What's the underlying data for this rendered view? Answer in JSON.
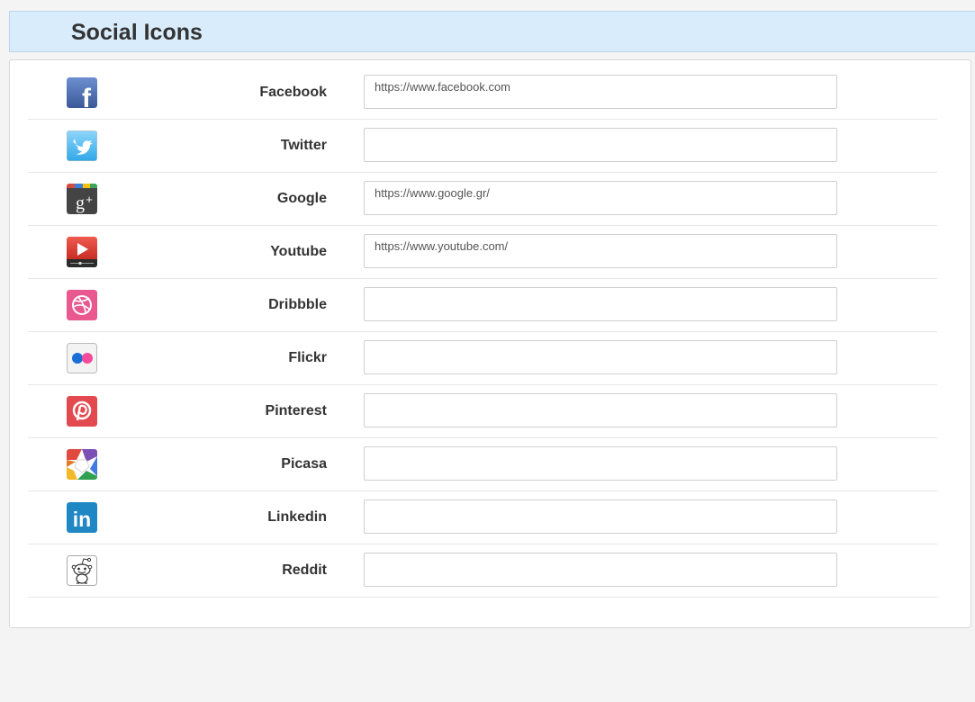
{
  "header": {
    "title": "Social Icons"
  },
  "rows": [
    {
      "icon": "facebook-icon",
      "label": "Facebook",
      "value": "https://www.facebook.com",
      "color": "#3b5998"
    },
    {
      "icon": "twitter-icon",
      "label": "Twitter",
      "value": "",
      "color": "#4fb5f0"
    },
    {
      "icon": "google-plus-icon",
      "label": "Google",
      "value": "https://www.google.gr/",
      "color": "#444444"
    },
    {
      "icon": "youtube-icon",
      "label": "Youtube",
      "value": "https://www.youtube.com/",
      "color": "#d9251d"
    },
    {
      "icon": "dribbble-icon",
      "label": "Dribbble",
      "value": "",
      "color": "#ea4c89"
    },
    {
      "icon": "flickr-icon",
      "label": "Flickr",
      "value": "",
      "color": "#0063dc"
    },
    {
      "icon": "pinterest-icon",
      "label": "Pinterest",
      "value": "",
      "color": "#e0393e"
    },
    {
      "icon": "picasa-icon",
      "label": "Picasa",
      "value": "",
      "color": "#8e44ad"
    },
    {
      "icon": "linkedin-icon",
      "label": "Linkedin",
      "value": "",
      "color": "#1f8ac8"
    },
    {
      "icon": "reddit-icon",
      "label": "Reddit",
      "value": "",
      "color": "#333333"
    }
  ]
}
